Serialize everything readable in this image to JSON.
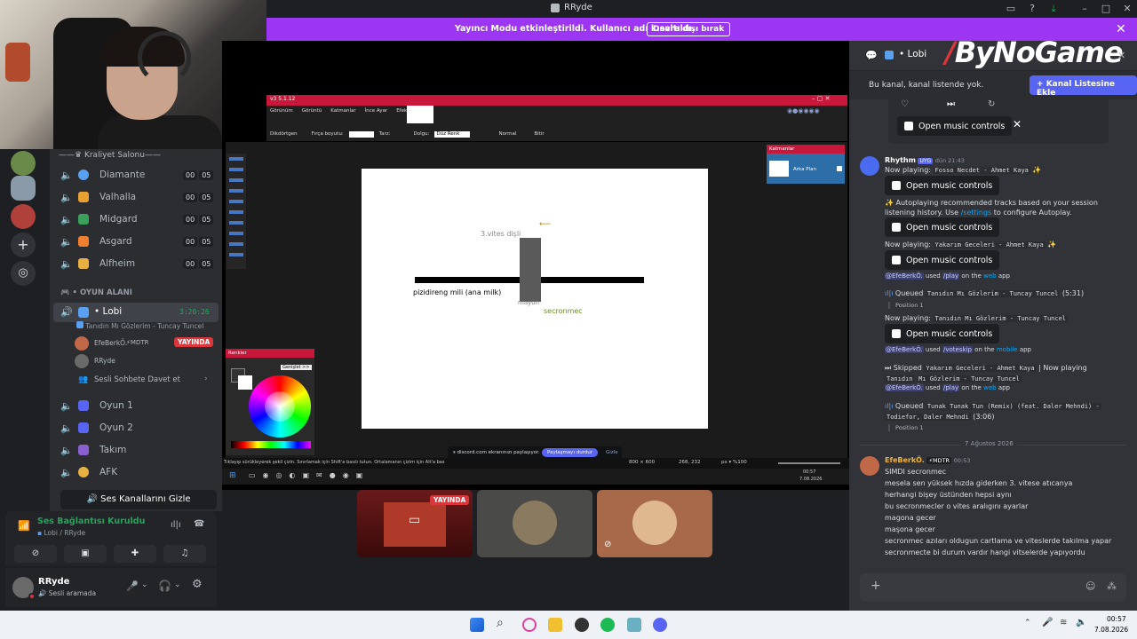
{
  "window": {
    "title": "RRyde"
  },
  "banner": {
    "message": "Yayıncı Modu etkinleştirildi. Kullanıcı adı kısaltıldı.",
    "button": "Devre dışı bırak"
  },
  "sidebar": {
    "channels_top": [
      {
        "name": "Kraliyet Salonu",
        "header": true
      },
      {
        "name": "Diamante",
        "count": [
          "00",
          "05"
        ],
        "color": "#5aa0f0"
      },
      {
        "name": "Valhalla",
        "count": [
          "00",
          "05"
        ],
        "color": "#e8a030"
      },
      {
        "name": "Midgard",
        "count": [
          "00",
          "05"
        ],
        "color": "#3aa05a"
      },
      {
        "name": "Asgard",
        "count": [
          "00",
          "05"
        ],
        "color": "#f08030"
      },
      {
        "name": "Alfheim",
        "count": [
          "00",
          "05"
        ],
        "color": "#e8b040"
      }
    ],
    "category": "OYUN ALANI",
    "active_channel": {
      "name": "Lobi",
      "time": "3:20:26",
      "activity": "Tanıdın Mı Gözlerim - Tuncay Tuncel"
    },
    "members": [
      {
        "name": "EfeBerkÖ.",
        "badge": "MDTR",
        "live": "YAYINDA"
      },
      {
        "name": "RRyde"
      }
    ],
    "invite": "Sesli Sohbete Davet et",
    "channels_bottom": [
      {
        "name": "Oyun 1"
      },
      {
        "name": "Oyun 2"
      },
      {
        "name": "Takım"
      },
      {
        "name": "AFK"
      }
    ],
    "hide_voice": "Ses Kanallarını Gizle"
  },
  "voice": {
    "status": "Ses Bağlantısı Kuruldu",
    "location": "Lobi / RRyde"
  },
  "user": {
    "name": "RRyde",
    "status": "Sesli aramada"
  },
  "stream": {
    "paint": {
      "title": "v3 5.1.12",
      "menu": [
        "Görünüm",
        "Görüntü",
        "Katmanlar",
        "İnce Ayar",
        "Efektler"
      ],
      "toolbar": [
        "Dikdörtgen",
        "Fırça boyutu:",
        "Tarz:",
        "Dolgu:",
        "Düz Renk",
        "Normal",
        "Bitir"
      ],
      "layers_title": "Katmanlar",
      "layer_name": "Arka Plan",
      "colors_title": "Renkler",
      "colors_expand": "Genişlet >>",
      "status_hint": "Tıklayıp sürükleyerek şekil çizin. Sınırlamak için Shift'e basılı tutun. Ortalamanın çizim için Alt'a bas",
      "size": "800 × 600",
      "coords": "268, 232",
      "zoom": "%100",
      "clock": "00:57",
      "date": "7.08.2026"
    },
    "canvas_labels": {
      "gear": "3.vites dişli",
      "shaft": "pizidireng mili (ana milk)",
      "hub": "mayon",
      "sync": "secronmec"
    },
    "share_notice": "discord.com ekranınızı paylaşıyor.",
    "share_stop": "Paylaşmayı durdur",
    "share_hide": "Gizle",
    "live_badge": "YAYINDA"
  },
  "chat": {
    "channel": "Lobi",
    "watermark": "ByNoGame",
    "notice": "Bu kanal, kanal listende yok.",
    "add_button": "Kanal Listesine Ekle",
    "music_button": "Open music controls",
    "bot": {
      "name": "Rhythm",
      "tag": "UYG",
      "time": "dün 21:43"
    },
    "lines": {
      "np1": "Now playing:",
      "np1_track": "Fosso Necdet - Ahmet Kaya",
      "auto": "Autoplaying recommended tracks based on your session listening history. Use",
      "auto_cmd": "/settings",
      "auto_end": "to configure Autoplay.",
      "np2_track": "Yakarım Geceleri - Ahmet Kaya",
      "used_user": "@EfeBerkÖ.",
      "used": "used",
      "play_cmd": "/play",
      "on_the": "on the",
      "web": "web",
      "app": "app",
      "queued": "Queued",
      "queued_track1": "Tanıdın Mı Gözlerim - Tuncay Tuncel",
      "queued_time1": "(5:31)",
      "position": "Position 1",
      "np3_track": "Tanıdın Mı Gözlerim - Tuncay Tuncel",
      "voteskip": "/voteskip",
      "mobile": "mobile",
      "skipped": "Skipped",
      "skipped_track": "Yakarım Geceleri - Ahmet Kaya",
      "now_playing_sep": "| Now playing",
      "skipped_np": "Tanıdın",
      "skipped_np2": "Mı Gözlerim - Tuncay Tuncel",
      "queued_track2": "Tunak Tunak Tun (Remix) (feat. Daler Mehndi) -",
      "queued_track2b": "Todiefor, Daler Mehndi",
      "queued_time2": "(3:06)"
    },
    "date_divider": "7 Ağustos 2026",
    "user_msg": {
      "name": "EfeBerkÖ.",
      "badge": "MDTR",
      "time": "00:53",
      "lines": [
        "SIMDI secronmec",
        "mesela sen yüksek hızda giderken 3. vitese atıcanya",
        "herhangi bişey üstünden hepsi aynı",
        "bu secronmecler o vites aralıgını ayarlar",
        "magona gecer",
        "maşona gecer",
        "secronmec azıları oldugun cartlama ve viteslerde takılma yapar",
        "secronmecte bi durum vardır hangi vitselerde yapıyordu"
      ]
    }
  },
  "taskbar": {
    "time": "00:57",
    "date": "7.08.2026"
  },
  "colors": {
    "accent": "#5865f2",
    "banner": "#9d36f2",
    "live": "#da373c",
    "green": "#23a55a"
  }
}
